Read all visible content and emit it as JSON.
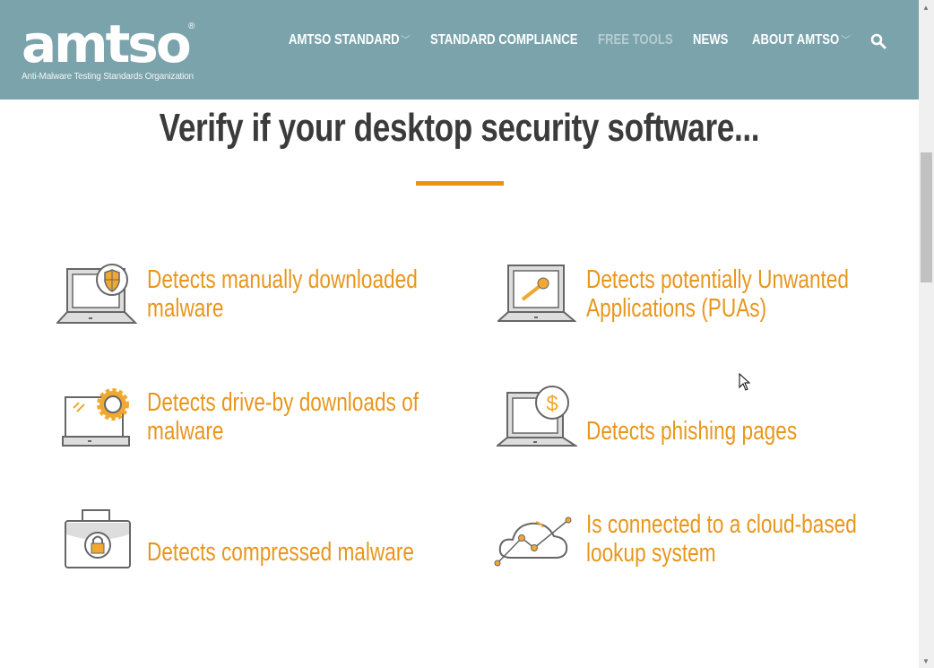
{
  "header": {
    "logo_text": "amtso",
    "logo_tagline": "Anti-Malware Testing Standards Organization",
    "nav": [
      {
        "label": "AMTSO STANDARD",
        "dropdown": true
      },
      {
        "label": "STANDARD COMPLIANCE"
      },
      {
        "label": "FREE TOOLS",
        "active": true
      },
      {
        "label": "NEWS"
      },
      {
        "label": "ABOUT AMTSO",
        "dropdown": true
      }
    ],
    "search_icon": "search-icon"
  },
  "main": {
    "title": "Verify if your desktop security software...",
    "features": [
      {
        "line1": "Detects manually downloaded",
        "line2": "malware",
        "icon": "laptop-shield-icon"
      },
      {
        "line1": "Detects potentially Unwanted",
        "line2": "Applications (PUAs)",
        "icon": "laptop-key-icon"
      },
      {
        "line1": "Detects drive-by downloads of",
        "line2": "malware",
        "icon": "laptop-gear-icon"
      },
      {
        "line1": "",
        "line2": "Detects phishing pages",
        "icon": "laptop-dollar-icon"
      },
      {
        "line1": "",
        "line2": "Detects compressed malware",
        "icon": "briefcase-lock-icon"
      },
      {
        "line1": "Is connected to a cloud-based",
        "line2": "lookup system",
        "icon": "cloud-graph-icon"
      }
    ]
  },
  "colors": {
    "header": "#7ba3ab",
    "accent": "#e8961c",
    "title": "#3b3b3b"
  }
}
